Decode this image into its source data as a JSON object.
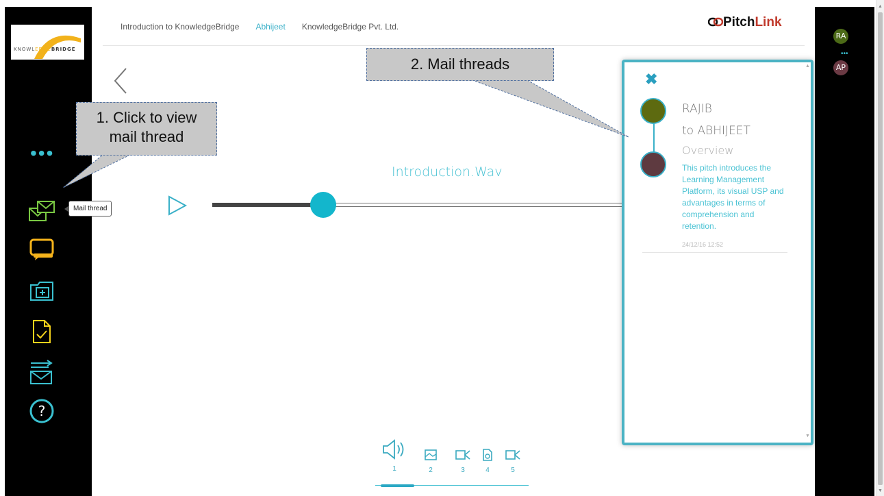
{
  "header": {
    "nav": [
      "Introduction to KnowledgeBridge",
      "Abhijeet",
      "KnowledgeBridge Pvt. Ltd."
    ],
    "active_nav_index": 1,
    "logo_prefix": "Pitch",
    "logo_suffix": "Link"
  },
  "brand": {
    "text_a": "KNOWL",
    "text_b": "EDGE",
    "text_c": "BRIDGE"
  },
  "sidebar": {
    "more": "•••",
    "icons": [
      "mail-thread-icon",
      "chat-icon",
      "add-folder-icon",
      "document-check-icon",
      "forward-mail-icon",
      "help-icon"
    ],
    "tooltip": "Mail thread",
    "help_glyph": "?"
  },
  "participants": [
    {
      "initials": "RA",
      "color": "#4c6a17"
    },
    {
      "initials": "AP",
      "color": "#6b3a44"
    }
  ],
  "participants_more": "•••",
  "player": {
    "title": "Introduction.Wav",
    "progress": 0.27
  },
  "media": [
    {
      "icon": "audio-icon",
      "num": "1"
    },
    {
      "icon": "image-icon",
      "num": "2"
    },
    {
      "icon": "video-icon",
      "num": "3"
    },
    {
      "icon": "file-icon",
      "num": "4"
    },
    {
      "icon": "video-icon",
      "num": "5"
    }
  ],
  "mail_thread": {
    "close": "✖",
    "from": "RAJIB",
    "to": "to ABHIJEET",
    "subject": "Overview",
    "body": "This pitch introduces the Learning Management Platform, its visual USP and advantages in terms of comprehension and retention.",
    "timestamp": "24/12/16 12:52",
    "dot_colors": [
      "#5d6a10",
      "#5e3a40"
    ]
  },
  "callouts": {
    "one_line1": "1. Click to view",
    "one_line2": "mail thread",
    "two": "2. Mail threads"
  },
  "colors": {
    "accent": "#4cc3d4",
    "knob": "#13b6cc",
    "panel_border": "#4bb3c4"
  }
}
